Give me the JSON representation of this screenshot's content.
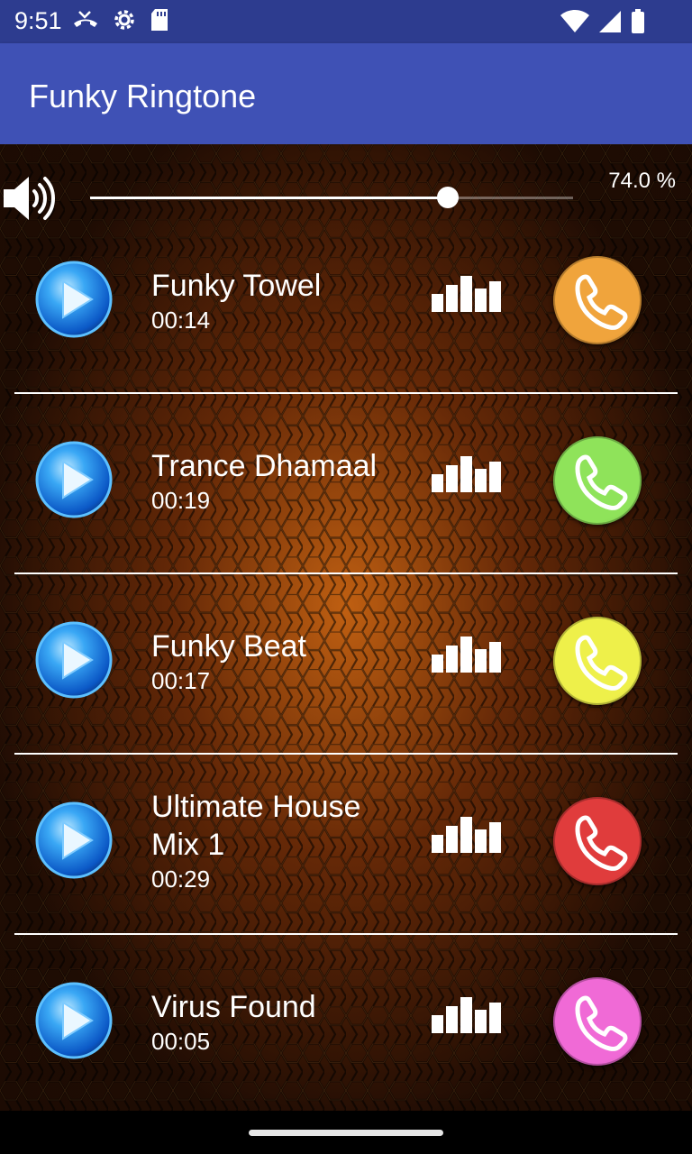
{
  "status_bar": {
    "time": "9:51",
    "left_icons": [
      "missed-call-icon",
      "settings-icon",
      "sd-card-icon"
    ],
    "right_icons": [
      "wifi-icon",
      "signal-icon",
      "battery-icon"
    ]
  },
  "app_bar": {
    "title": "Funky Ringtone"
  },
  "volume": {
    "icon": "speaker-icon",
    "level_percent": 74.0,
    "label": "74.0 %"
  },
  "ringtones": [
    {
      "name": "Funky Towel",
      "duration": "00:14",
      "call_color": "#f0a43c"
    },
    {
      "name": "Trance Dhamaal",
      "duration": "00:19",
      "call_color": "#8fe35a"
    },
    {
      "name": "Funky Beat",
      "duration": "00:17",
      "call_color": "#eef04a"
    },
    {
      "name": "Ultimate House Mix 1",
      "duration": "00:29",
      "call_color": "#e03c3c"
    },
    {
      "name": "Virus Found",
      "duration": "00:05",
      "call_color": "#f06ad6"
    }
  ],
  "icons": {
    "play": "play-icon",
    "equalizer": "equalizer-icon",
    "set_ringtone": "phone-icon"
  },
  "colors": {
    "app_bar": "#3f51b5",
    "status_bar": "#2d3c8f",
    "accent": "#ffffff"
  }
}
